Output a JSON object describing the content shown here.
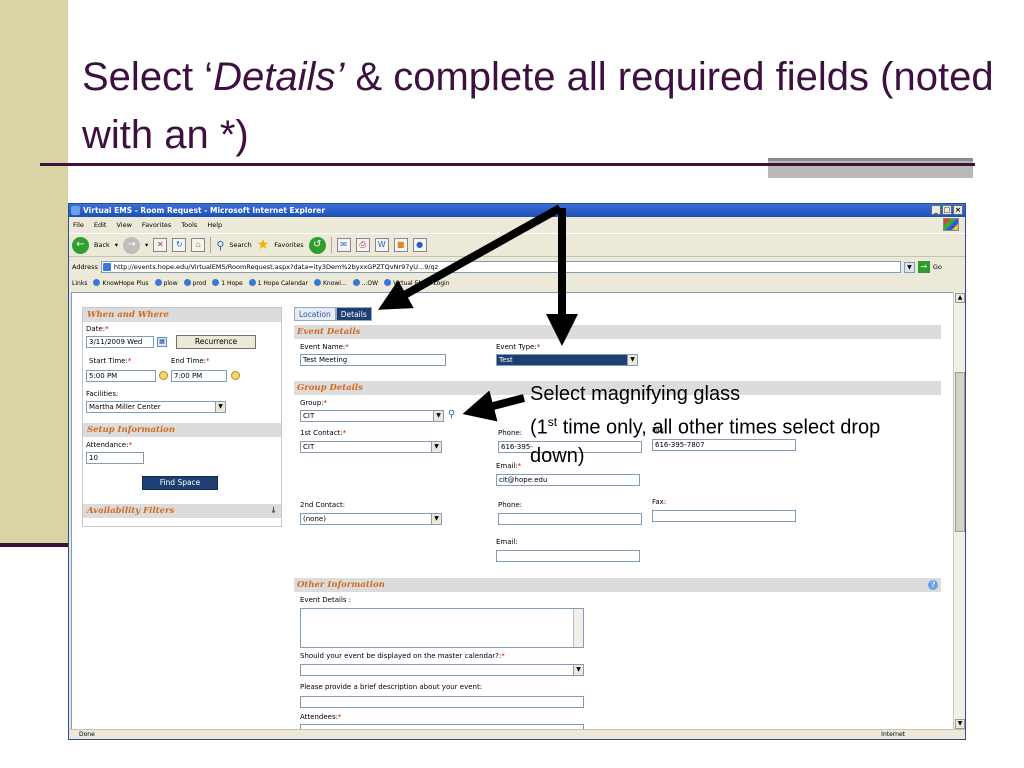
{
  "slide": {
    "title_pre": "Select ‘",
    "title_em": "Details’",
    "title_post": " & complete all required fields (noted with an *)",
    "callout_line1": "Select magnifying glass",
    "callout_open": "(1",
    "callout_sup": "st",
    "callout_rest": " time only, all other times select drop down)"
  },
  "browser": {
    "title": "Virtual EMS - Room Request - Microsoft Internet Explorer",
    "window_buttons": [
      "_",
      "□",
      "×"
    ],
    "menu": [
      "File",
      "Edit",
      "View",
      "Favorites",
      "Tools",
      "Help"
    ],
    "toolbar": {
      "back": "Back",
      "search": "Search",
      "favorites": "Favorites"
    },
    "address_label": "Address",
    "address_url": "http://events.hope.edu/VirtualEMS/RoomRequest.aspx?data=ity3Dem%2byxxGPZTQvNr97yU...9/qz",
    "go_label": "Go",
    "links_label": "Links",
    "links": [
      "KnowHope Plus",
      "plow",
      "prod",
      "1 Hope",
      "1 Hope Calendar",
      "Knowi...",
      "...OW",
      "Virtual EMS - Login"
    ],
    "status": "Done",
    "status_zone": "Internet"
  },
  "left_panel": {
    "when_where_header": "When and Where",
    "date_label": "Date:",
    "date_value": "3/11/2009 Wed",
    "recurrence_button": "Recurrence",
    "start_time_label": "Start Time:",
    "start_time_value": "5:00 PM",
    "end_time_label": "End Time:",
    "end_time_value": "7:00 PM",
    "facilities_label": "Facilities:",
    "facilities_value": "Martha Miller Center",
    "setup_header": "Setup Information",
    "attendance_label": "Attendance:",
    "attendance_value": "10",
    "find_space_button": "Find Space",
    "availability_header": "Availability Filters"
  },
  "right_panel": {
    "tab_location": "Location",
    "tab_details": "Details",
    "event_details_header": "Event Details",
    "event_name_label": "Event Name:",
    "event_name_value": "Test Meeting",
    "event_type_label": "Event Type:",
    "event_type_value": "Test",
    "group_details_header": "Group Details",
    "group_label": "Group:",
    "group_value": "CIT",
    "first_contact_label": "1st Contact:",
    "first_contact_value": "CIT",
    "phone_label": "Phone:",
    "phone_value": "616-395-",
    "fax_label": "Fax:",
    "fax_value": "616-395-7807",
    "email_label": "Email:",
    "email_value": "cit@hope.edu",
    "second_contact_label": "2nd Contact:",
    "second_contact_value": "(none)",
    "phone2_label": "Phone:",
    "fax2_label": "Fax:",
    "email2_label": "Email:",
    "other_info_header": "Other Information",
    "event_details_label": "Event Details :",
    "master_calendar_label": "Should your event be displayed on the master calendar?:",
    "description_label": "Please provide a brief description about your event:",
    "attendees_label": "Attendees:"
  },
  "symbols": {
    "required": "*",
    "dropdown": "▼",
    "help": "?"
  },
  "colors": {
    "title": "#3d1040",
    "section_header": "#d2691e",
    "tab_active": "#1e3f74",
    "required": "#cc0000"
  }
}
